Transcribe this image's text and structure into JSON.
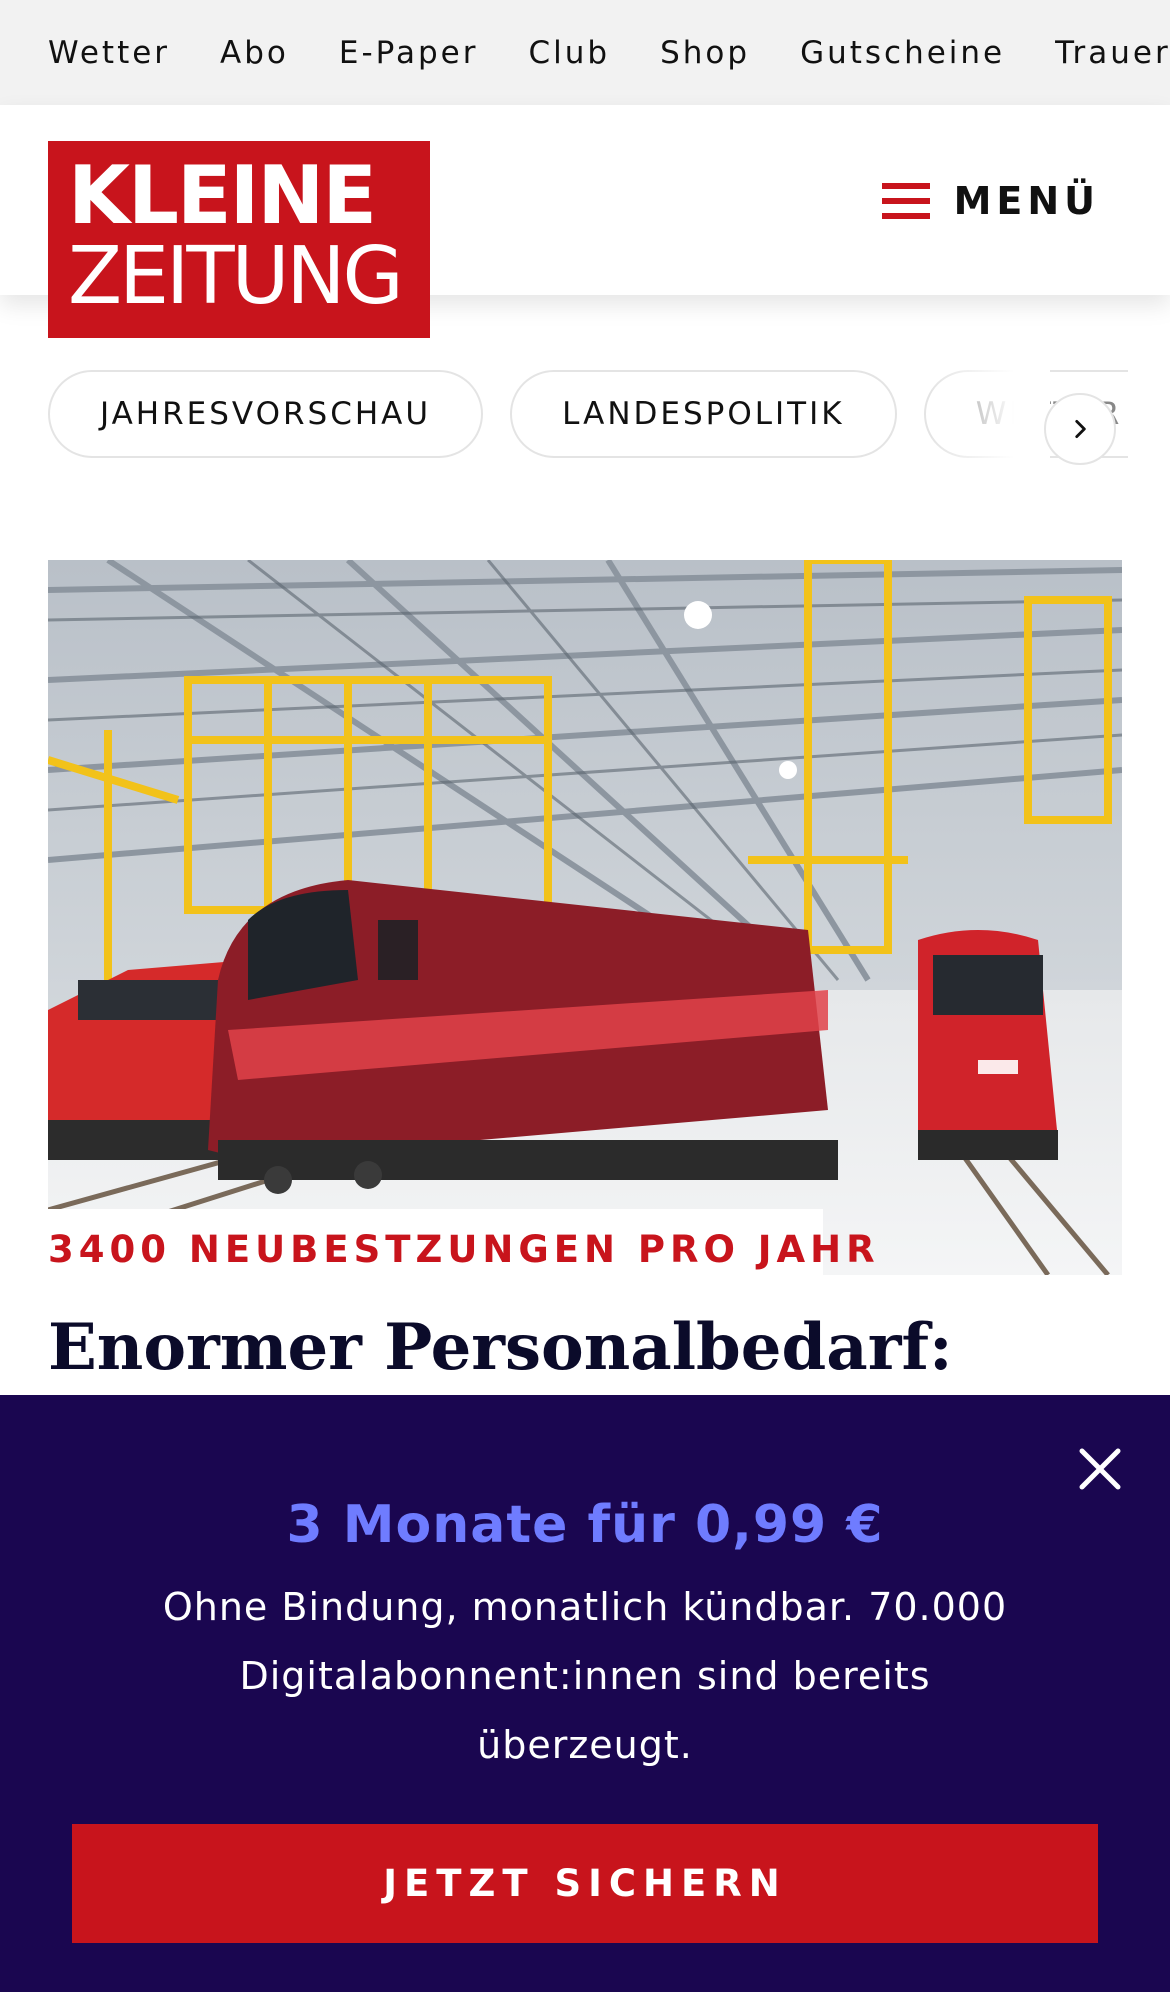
{
  "topnav": {
    "items": [
      "Wetter",
      "Abo",
      "E-Paper",
      "Club",
      "Shop",
      "Gutscheine",
      "Trauerportal"
    ]
  },
  "header": {
    "logo_line1": "KLEINE",
    "logo_line2": "ZEITUNG",
    "menu_label": "MENÜ"
  },
  "topics": {
    "items": [
      "JAHRESVORSCHAU",
      "LANDESPOLITIK",
      "WETTER"
    ],
    "next_icon": "chevron-right-icon"
  },
  "article": {
    "image_alt": "ÖBB",
    "kicker": "3400 NEUBESTZUNGEN PRO JAHR",
    "headline": "Enormer Personalbedarf:"
  },
  "promo": {
    "title": "3 Monate für 0,99 €",
    "text": "Ohne Bindung, monatlich kündbar. 70.000 Digitalabonnent:innen sind bereits überzeugt.",
    "cta_label": "JETZT SICHERN",
    "close_icon": "close-icon"
  },
  "colors": {
    "brand_red": "#c8141c",
    "promo_bg": "#1a0650",
    "promo_accent": "#6f7cff"
  }
}
